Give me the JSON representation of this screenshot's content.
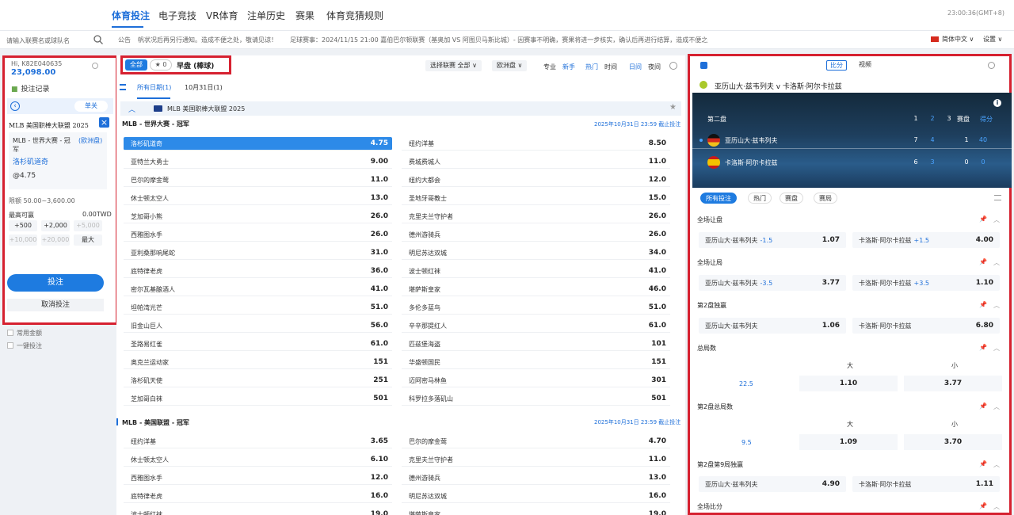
{
  "topnav": {
    "items": [
      "体育投注",
      "电子竞技",
      "VR体育",
      "注单历史",
      "赛果",
      "体育竞猜规则"
    ],
    "clock": "23:00:36(GMT+8)"
  },
  "notice": {
    "search_placeholder": "请输入联赛名或球队名",
    "label": "公告",
    "text": "帆状况后再另行通知。造成不便之处，敬请见谅！　　足球赛事：2024/11/15 21:00 嘉伯巴尔顿联赛（基奥加 VS 阿图贝马斯比城）- 因赛事不明确，赛果将进一步核实，确认后再进行结算，造成不便之处，敬请",
    "language": "简体中文 ∨",
    "settings": "设置 ∨"
  },
  "account": {
    "id": "Hi, K82E040635",
    "balance": "23,098.00",
    "bet_record": "投注记录"
  },
  "slip": {
    "close": "单关",
    "league": "MLB 美国职棒大联盟 2025",
    "market": "MLB - 世界大赛 - 冠军",
    "odds_type": "(欧洲盘)",
    "selection": "洛杉矶道奇",
    "odds": "@4.75",
    "limit": "限额 50.00~3,600.00",
    "max_win_label": "最高可赢",
    "max_win_value": "0.00TWD",
    "chips": [
      "+500",
      "+2,000",
      "+5,000",
      "+10,000",
      "+20,000",
      "最大"
    ],
    "place": "投注",
    "cancel": "取消投注",
    "options": [
      "常用金额",
      "一键投注"
    ]
  },
  "filter": {
    "all": "全部",
    "fav_count": "0",
    "title": "早盘 (棒球)",
    "select_league": "选择联赛 全部 ∨",
    "select_odds": "欧洲盘 ∨",
    "sort_labels": [
      "专业",
      "新手",
      "热门",
      "时间",
      "日间",
      "夜间"
    ]
  },
  "date_tabs": [
    "所有日期(1)",
    "10月31日(1)"
  ],
  "league": "MLB 美国职棒大联盟 2025",
  "section1": {
    "title": "MLB - 世界大赛 - 冠军",
    "deadline": "2025年10月31日 23:59 截止投注",
    "left": [
      {
        "team": "洛杉矶道奇",
        "odds": "4.75"
      },
      {
        "team": "亚特兰大勇士",
        "odds": "9.00"
      },
      {
        "team": "巴尔的摩金莺",
        "odds": "11.0"
      },
      {
        "team": "休士顿太空人",
        "odds": "13.0"
      },
      {
        "team": "芝加哥小熊",
        "odds": "26.0"
      },
      {
        "team": "西雅图水手",
        "odds": "26.0"
      },
      {
        "team": "亚利桑那响尾蛇",
        "odds": "31.0"
      },
      {
        "team": "底特律老虎",
        "odds": "36.0"
      },
      {
        "team": "密尔瓦基酿酒人",
        "odds": "41.0"
      },
      {
        "team": "坦帕湾光芒",
        "odds": "51.0"
      },
      {
        "team": "旧金山巨人",
        "odds": "56.0"
      },
      {
        "team": "圣路易红雀",
        "odds": "61.0"
      },
      {
        "team": "奥克兰运动家",
        "odds": "151"
      },
      {
        "team": "洛杉矶天使",
        "odds": "251"
      },
      {
        "team": "芝加哥白袜",
        "odds": "501"
      }
    ],
    "right": [
      {
        "team": "纽约洋基",
        "odds": "8.50"
      },
      {
        "team": "费城费城人",
        "odds": "11.0"
      },
      {
        "team": "纽约大都会",
        "odds": "12.0"
      },
      {
        "team": "圣地牙哥教士",
        "odds": "15.0"
      },
      {
        "team": "克里夫兰守护者",
        "odds": "26.0"
      },
      {
        "team": "德州游骑兵",
        "odds": "26.0"
      },
      {
        "team": "明尼苏达双城",
        "odds": "34.0"
      },
      {
        "team": "波士顿红袜",
        "odds": "41.0"
      },
      {
        "team": "堪萨斯皇家",
        "odds": "46.0"
      },
      {
        "team": "多伦多蓝鸟",
        "odds": "51.0"
      },
      {
        "team": "辛辛那提红人",
        "odds": "61.0"
      },
      {
        "team": "匹兹堡海盗",
        "odds": "101"
      },
      {
        "team": "华盛顿国民",
        "odds": "151"
      },
      {
        "team": "迈阿密马林鱼",
        "odds": "301"
      },
      {
        "team": "科罗拉多落矶山",
        "odds": "501"
      }
    ]
  },
  "section2": {
    "title": "MLB - 美国联盟 - 冠军",
    "deadline": "2025年10月31日 23:59 截止投注",
    "left": [
      {
        "team": "纽约洋基",
        "odds": "3.65"
      },
      {
        "team": "休士顿太空人",
        "odds": "6.10"
      },
      {
        "team": "西雅图水手",
        "odds": "12.0"
      },
      {
        "team": "底特律老虎",
        "odds": "16.0"
      },
      {
        "team": "波士顿红袜",
        "odds": "19.0"
      }
    ],
    "right": [
      {
        "team": "巴尔的摩金莺",
        "odds": "4.70"
      },
      {
        "team": "克里夫兰守护者",
        "odds": "11.0"
      },
      {
        "team": "德州游骑兵",
        "odds": "13.0"
      },
      {
        "team": "明尼苏达双城",
        "odds": "16.0"
      },
      {
        "team": "堪萨斯皇家",
        "odds": "19.0"
      }
    ]
  },
  "right": {
    "tabs": [
      "比分",
      "视频"
    ],
    "match": "亚历山大·兹韦列夫 v 卡洛斯·阿尔卡拉兹",
    "sb_set": "第二盘",
    "sb_cols": [
      "1",
      "2",
      "3",
      "赛盘",
      "得分"
    ],
    "p1": {
      "name": "亚历山大·兹韦列夫",
      "scores": [
        "7",
        "4",
        "",
        "1",
        "40"
      ]
    },
    "p2": {
      "name": "卡洛斯·阿尔卡拉兹",
      "scores": [
        "6",
        "3",
        "",
        "0",
        "0"
      ]
    },
    "market_tabs": [
      "所有投注",
      "热门",
      "赛盘",
      "赛局"
    ],
    "markets": {
      "m1": {
        "title": "全场让盘",
        "a_name": "亚历山大·兹韦列夫",
        "a_hc": "-1.5",
        "a_odds": "1.07",
        "b_name": "卡洛斯·阿尔卡拉兹",
        "b_hc": "+1.5",
        "b_odds": "4.00"
      },
      "m2": {
        "title": "全场让局",
        "a_name": "亚历山大·兹韦列夫",
        "a_hc": "-3.5",
        "a_odds": "3.77",
        "b_name": "卡洛斯·阿尔卡拉兹",
        "b_hc": "+3.5",
        "b_odds": "1.10"
      },
      "m3": {
        "title": "第2盘独赢",
        "a_name": "亚历山大·兹韦列夫",
        "a_odds": "1.06",
        "b_name": "卡洛斯·阿尔卡拉兹",
        "b_odds": "6.80"
      },
      "m4": {
        "title": "总局数",
        "over": "大",
        "under": "小",
        "line": "22.5",
        "over_odds": "1.10",
        "under_odds": "3.77"
      },
      "m5": {
        "title": "第2盘总局数",
        "over": "大",
        "under": "小",
        "line": "9.5",
        "over_odds": "1.09",
        "under_odds": "3.70"
      },
      "m6": {
        "title": "第2盘第9局独赢",
        "a_name": "亚历山大·兹韦列夫",
        "a_odds": "4.90",
        "b_name": "卡洛斯·阿尔卡拉兹",
        "b_odds": "1.11"
      },
      "m7": {
        "title": "全场比分"
      }
    }
  }
}
